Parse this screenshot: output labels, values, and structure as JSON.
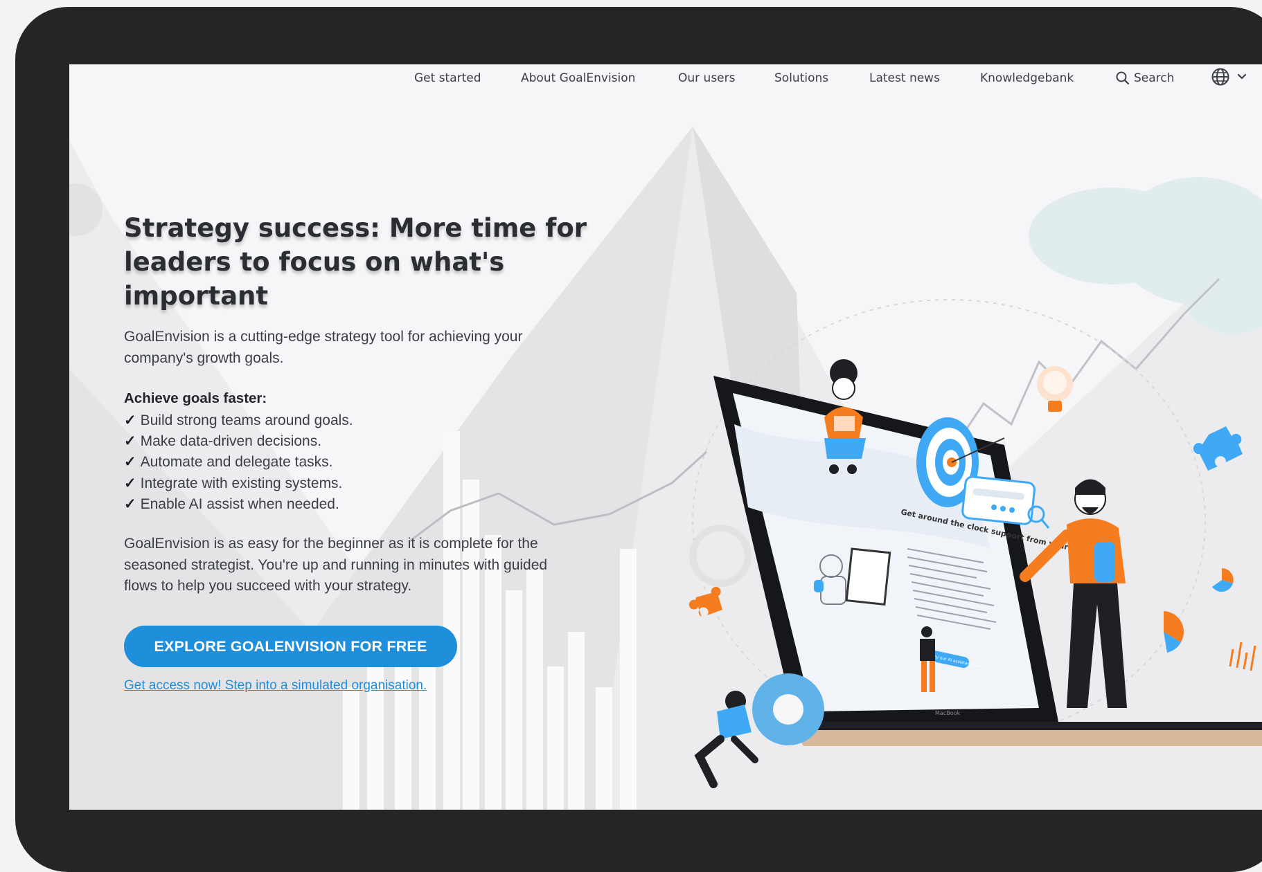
{
  "nav": {
    "items": [
      "Get started",
      "About GoalEnvision",
      "Our users",
      "Solutions",
      "Latest news",
      "Knowledgebank"
    ],
    "search_label": "Search",
    "language_icon": "globe-icon"
  },
  "hero": {
    "title": "Strategy success: More time for leaders to focus on what's important",
    "intro": "GoalEnvision is a cutting-edge strategy tool for achieving your company's growth goals.",
    "features_heading": "Achieve goals faster:",
    "check_mark": "✓",
    "features": [
      "Build strong teams around goals.",
      "Make data-driven decisions.",
      "Automate and delegate tasks.",
      "Integrate with existing systems.",
      "Enable AI assist when needed."
    ],
    "description": "GoalEnvision is as easy for the beginner as it is complete for the seasoned strategist. You're up and running in minutes with guided flows to help you succeed with your strategy.",
    "cta_label": "EXPLORE GOALENVISION FOR FREE",
    "secondary_link": "Get access now! Step into a simulated organisation."
  },
  "illustration": {
    "laptop_screen_heading": "Get around the clock support from your AI-assistant",
    "laptop_button": "Try our AI assistant now",
    "laptop_brand": "MacBook"
  },
  "colors": {
    "accent": "#1f8fdc",
    "orange": "#f57c1f",
    "light_blue": "#3fa9f5",
    "device_frame": "#252525"
  }
}
